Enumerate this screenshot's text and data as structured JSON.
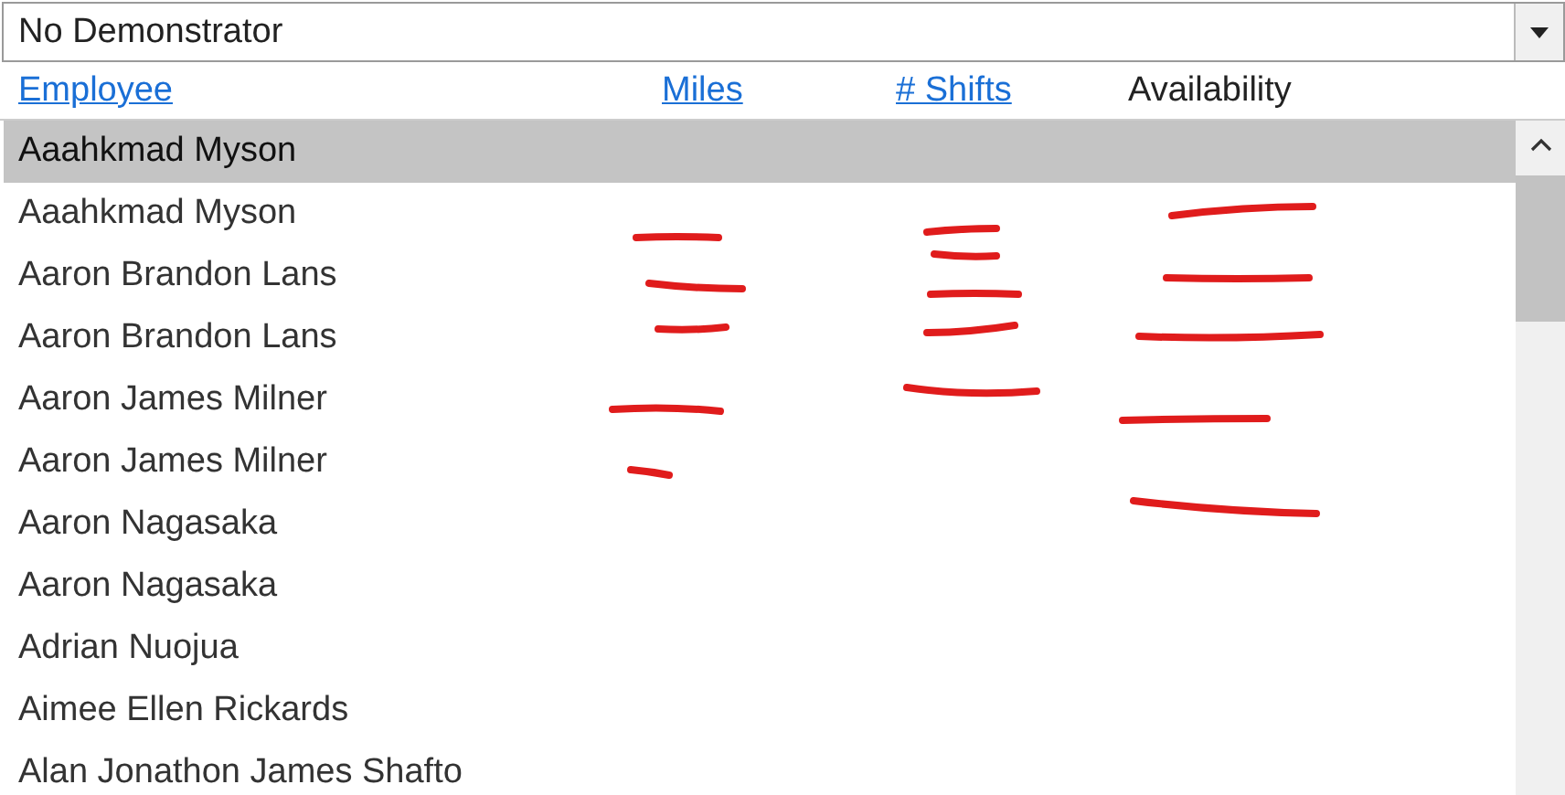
{
  "dropdown": {
    "value": "No Demonstrator"
  },
  "columns": [
    {
      "label": "Employee",
      "kind": "link"
    },
    {
      "label": "Miles",
      "kind": "link"
    },
    {
      "label": "# Shifts",
      "kind": "link"
    },
    {
      "label": "Availability",
      "kind": "plain"
    }
  ],
  "rows": [
    {
      "name": "Aaahkmad Myson",
      "selected": true
    },
    {
      "name": "Aaahkmad Myson",
      "selected": false
    },
    {
      "name": "Aaron Brandon Lans",
      "selected": false
    },
    {
      "name": "Aaron Brandon Lans",
      "selected": false
    },
    {
      "name": "Aaron James Milner",
      "selected": false
    },
    {
      "name": "Aaron James Milner",
      "selected": false
    },
    {
      "name": "Aaron Nagasaka",
      "selected": false
    },
    {
      "name": "Aaron Nagasaka",
      "selected": false
    },
    {
      "name": "Adrian Nuojua",
      "selected": false
    },
    {
      "name": "Aimee Ellen Rickards",
      "selected": false
    },
    {
      "name": "Alan Jonathon James Shafto",
      "selected": false
    }
  ]
}
